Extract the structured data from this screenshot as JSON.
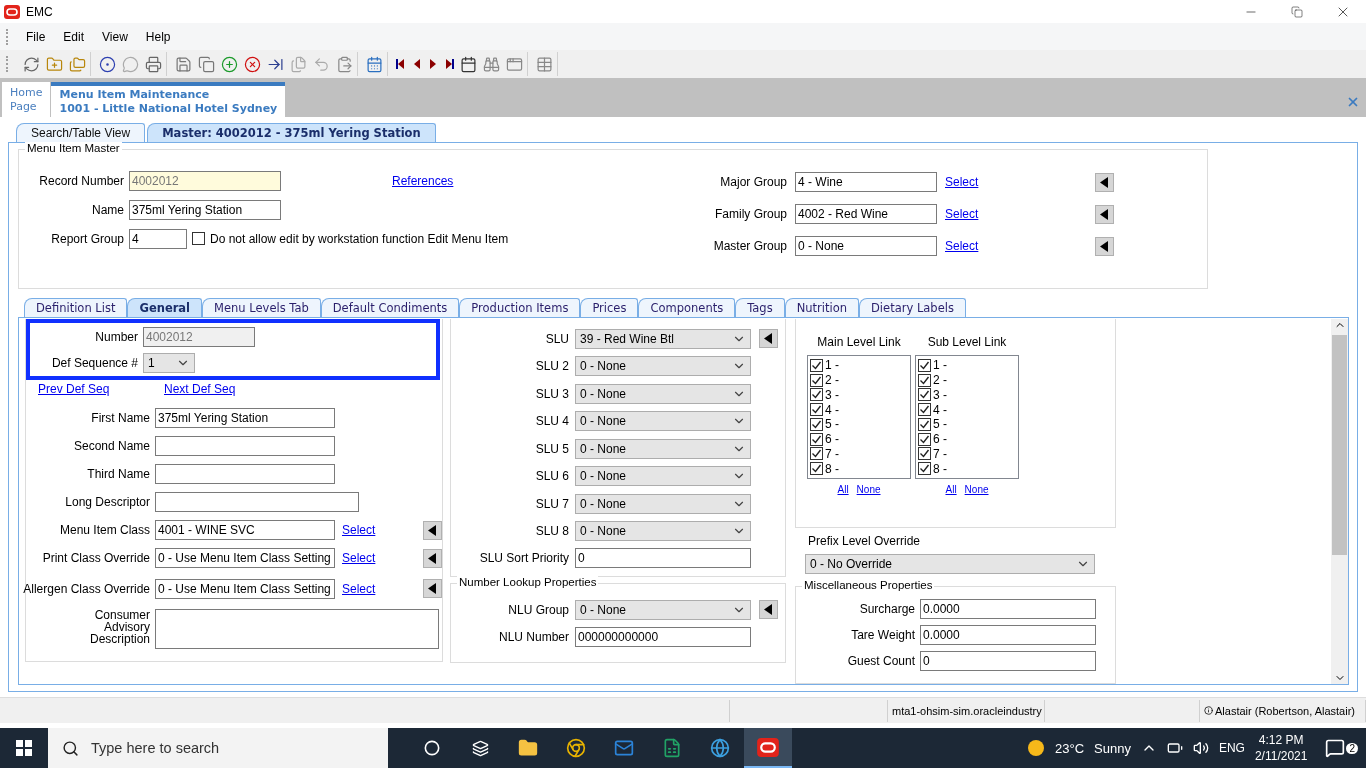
{
  "window": {
    "title": "EMC"
  },
  "menu": [
    "File",
    "Edit",
    "View",
    "Help"
  ],
  "document_tabs": [
    {
      "lines": [
        "Home",
        "Page"
      ],
      "selected": false
    },
    {
      "lines": [
        "Menu Item Maintenance",
        "1001 - Little National Hotel Sydney"
      ],
      "selected": true
    }
  ],
  "view_tabs": [
    {
      "label": "Search/Table View",
      "selected": false
    },
    {
      "label": "Master: 4002012 - 375ml Yering Station",
      "selected": true
    }
  ],
  "master": {
    "legend": "Menu Item Master",
    "fields": [
      {
        "label": "Record Number",
        "value": "4002012",
        "kind": "readonly"
      },
      {
        "label": "Name",
        "value": "375ml Yering Station",
        "kind": "text"
      },
      {
        "label": "Report Group",
        "value": "4",
        "kind": "short"
      }
    ],
    "checkbox": {
      "label": "Do not allow edit by workstation function Edit Menu Item",
      "checked": false
    },
    "references_link": "References",
    "groups": [
      {
        "label": "Major Group",
        "value": "4 - Wine",
        "link": "Select"
      },
      {
        "label": "Family Group",
        "value": "4002 - Red Wine",
        "link": "Select"
      },
      {
        "label": "Master Group",
        "value": "0 - None",
        "link": "Select"
      }
    ]
  },
  "detail_tabs": [
    {
      "label": "Definition List",
      "selected": false
    },
    {
      "label": "General",
      "selected": true
    },
    {
      "label": "Menu Levels Tab",
      "selected": false
    },
    {
      "label": "Default Condiments",
      "selected": false
    },
    {
      "label": "Production Items",
      "selected": false
    },
    {
      "label": "Prices",
      "selected": false
    },
    {
      "label": "Components",
      "selected": false
    },
    {
      "label": "Tags",
      "selected": false
    },
    {
      "label": "Nutrition",
      "selected": false
    },
    {
      "label": "Dietary Labels",
      "selected": false
    }
  ],
  "general": {
    "number": {
      "label": "Number",
      "value": "4002012"
    },
    "def_sequence": {
      "label": "Def Sequence #",
      "value": "1"
    },
    "prev_link": "Prev Def Seq",
    "next_link": "Next Def Seq",
    "name_fields": [
      {
        "label": "First Name",
        "value": "375ml Yering Station",
        "kind": "text"
      },
      {
        "label": "Second Name",
        "kind": "text"
      },
      {
        "label": "Third Name",
        "kind": "text"
      },
      {
        "label": "Long Descriptor",
        "kind": "wide"
      }
    ],
    "class_fields": [
      {
        "label": "Menu Item Class",
        "value": "4001 - WINE SVC",
        "link": "Select"
      },
      {
        "label": "Print Class Override",
        "value": "0 - Use Menu Item Class Setting",
        "link": "Select"
      },
      {
        "label": "Allergen Class Override",
        "value": "0 - Use Menu Item Class Setting",
        "link": "Select"
      }
    ],
    "advisory": {
      "label": "Consumer Advisory Description"
    },
    "slu_fields": [
      {
        "label": "SLU",
        "value": "39 - Red Wine Btl",
        "jump": true
      },
      {
        "label": "SLU 2",
        "value": "0 - None",
        "jump": false
      },
      {
        "label": "SLU 3",
        "value": "0 - None",
        "jump": false
      },
      {
        "label": "SLU 4",
        "value": "0 - None",
        "jump": false
      },
      {
        "label": "SLU 5",
        "value": "0 - None",
        "jump": false
      },
      {
        "label": "SLU 6",
        "value": "0 - None",
        "jump": false
      },
      {
        "label": "SLU 7",
        "value": "0 - None",
        "jump": false
      },
      {
        "label": "SLU 8",
        "value": "0 - None",
        "jump": false
      }
    ],
    "slu_sort_priority": {
      "label": "SLU Sort Priority",
      "value": "0"
    },
    "nlu": {
      "legend": "Number Lookup Properties",
      "group": {
        "label": "NLU Group",
        "value": "0 - None"
      },
      "number": {
        "label": "NLU Number",
        "value": "000000000000"
      }
    },
    "level_links": [
      {
        "title": "Main Level Link",
        "all": "All",
        "none": "None",
        "items": [
          {
            "label": "1 -",
            "checked": true
          },
          {
            "label": "2 -",
            "checked": true
          },
          {
            "label": "3 -",
            "checked": true
          },
          {
            "label": "4 -",
            "checked": true
          },
          {
            "label": "5 -",
            "checked": true
          },
          {
            "label": "6 -",
            "checked": true
          },
          {
            "label": "7 -",
            "checked": true
          },
          {
            "label": "8 -",
            "checked": true
          }
        ]
      },
      {
        "title": "Sub Level Link",
        "all": "All",
        "none": "None",
        "items": [
          {
            "label": "1 -",
            "checked": true
          },
          {
            "label": "2 -",
            "checked": true
          },
          {
            "label": "3 -",
            "checked": true
          },
          {
            "label": "4 -",
            "checked": true
          },
          {
            "label": "5 -",
            "checked": true
          },
          {
            "label": "6 -",
            "checked": true
          },
          {
            "label": "7 -",
            "checked": true
          },
          {
            "label": "8 -",
            "checked": true
          }
        ]
      }
    ],
    "prefix_override": {
      "label": "Prefix Level Override",
      "value": "0 - No Override"
    },
    "misc": {
      "legend": "Miscellaneous Properties",
      "fields": [
        {
          "label": "Surcharge",
          "value": "0.0000"
        },
        {
          "label": "Tare Weight",
          "value": "0.0000"
        },
        {
          "label": "Guest Count",
          "value": "0"
        }
      ]
    }
  },
  "status_bar": {
    "server": "mta1-ohsim-sim.oracleindustry",
    "user": "Alastair (Robertson, Alastair)"
  },
  "taskbar": {
    "search_placeholder": "Type here to search",
    "temperature": "23°C",
    "weather": "Sunny",
    "language": "ENG",
    "time": "4:12 PM",
    "date": "2/11/2021",
    "notifications": "2"
  }
}
